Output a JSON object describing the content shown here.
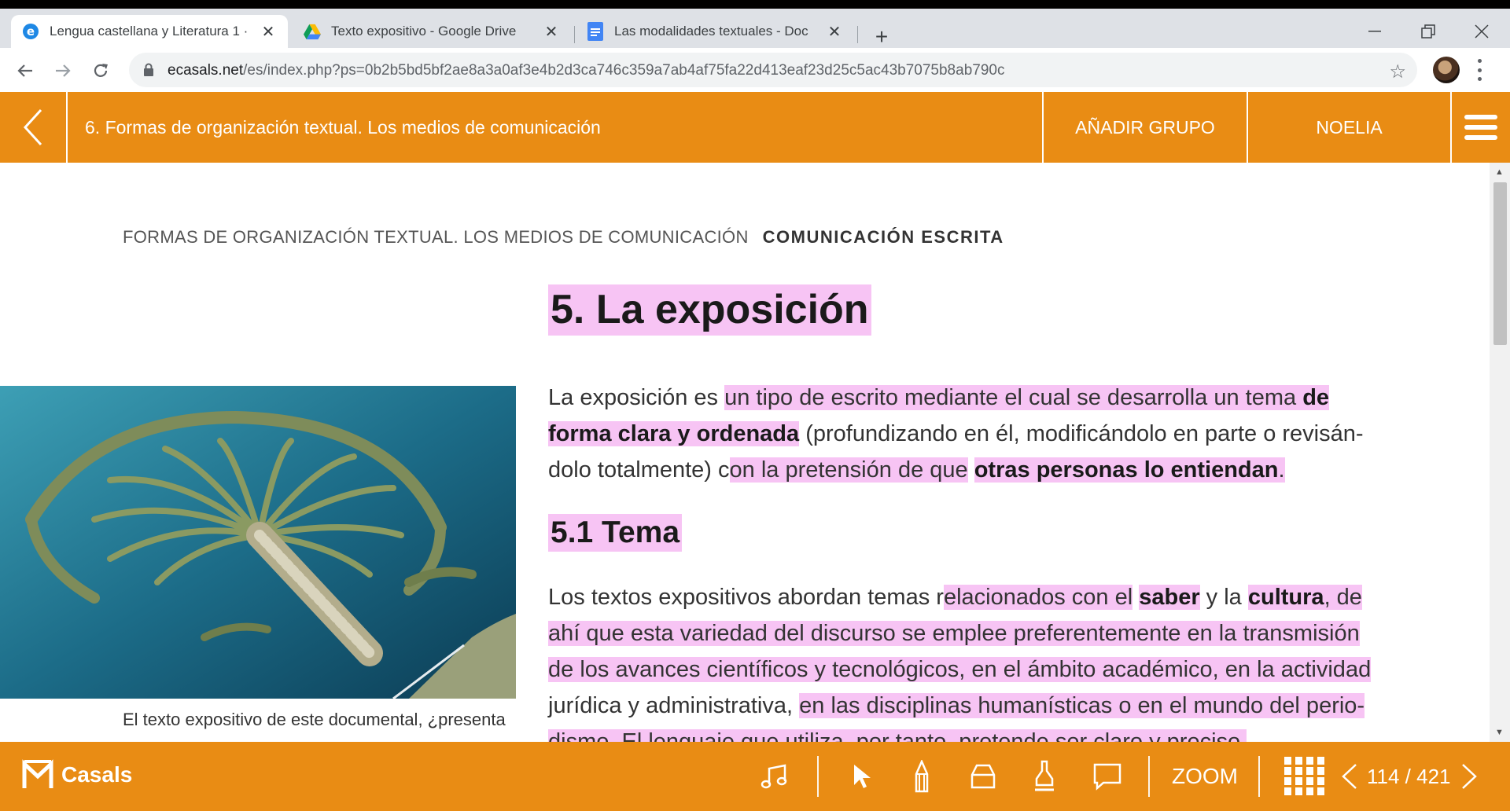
{
  "browser": {
    "tabs": [
      {
        "title": "Lengua castellana y Literatura 1 ·",
        "icon": "edge-e-icon"
      },
      {
        "title": "Texto expositivo - Google Drive",
        "icon": "google-drive-icon"
      },
      {
        "title": "Las modalidades textuales - Doc",
        "icon": "google-docs-icon"
      }
    ],
    "url_host": "ecasals.net",
    "url_path": "/es/index.php?ps=0b2b5bd5bf2ae8a3a0af3e4b2d3ca746c359a7ab4af75fa22d413eaf23d25c5ac43b7075b8ab790c"
  },
  "app": {
    "header_title": "6. Formas de organización textual. Los medios de comunicación",
    "add_group": "AÑADIR GRUPO",
    "user": "NOELIA",
    "accent": "#e98c14"
  },
  "page": {
    "running_head": "FORMAS DE ORGANIZACIÓN TEXTUAL. LOS MEDIOS DE COMUNICACIÓN",
    "running_section": "COMUNICACIÓN ESCRITA",
    "h1": "5. La exposición",
    "h2": "5.1 Tema",
    "caption": "El texto expositivo de este documental, ¿presenta",
    "highlight": "#f7c4f4"
  },
  "footer": {
    "brand": "Casals",
    "zoom": "ZOOM",
    "page_indicator": "114 / 421"
  }
}
